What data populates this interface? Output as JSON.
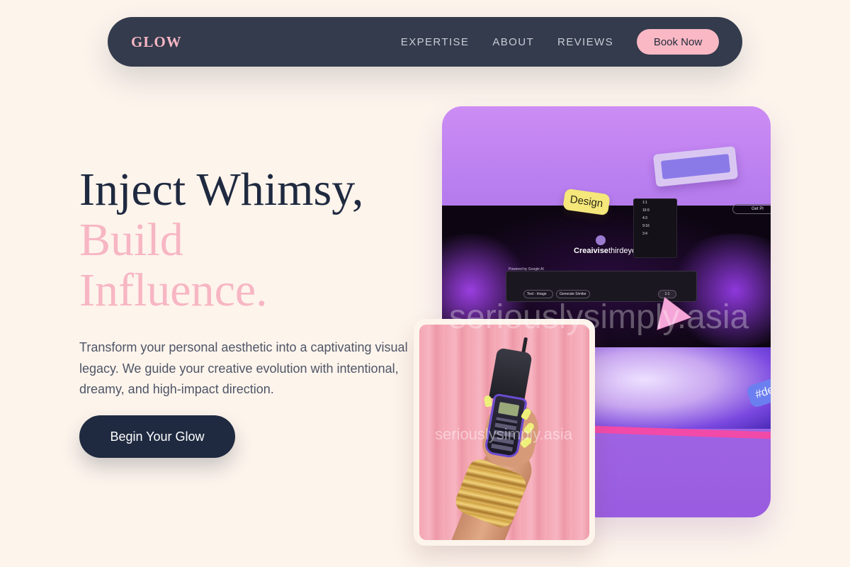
{
  "nav": {
    "logo": "GLOW",
    "links": [
      "EXPERTISE",
      "ABOUT",
      "REVIEWS"
    ],
    "cta": "Book Now"
  },
  "hero": {
    "headline_line1": "Inject Whimsy,",
    "headline_line2": "Build",
    "headline_line3": "Influence.",
    "description": "Transform your personal aesthetic into a captivating visual legacy. We guide your creative evolution with intentional, dreamy, and high-impact direction.",
    "cta": "Begin Your Glow"
  },
  "main_image": {
    "design_tag": "Design",
    "brand_bold": "Creaivise",
    "brand_light": "thirdeye",
    "powered_by": "Powered by Google AI",
    "chip_text_image": "Text - Image",
    "chip_generate_similar": "Generate Similar",
    "chip_ratio": "1:1",
    "ratios": [
      "1:1",
      "16:9",
      "4:3",
      "9:16",
      "3:4"
    ],
    "top_right_button": "Get Pl",
    "hash_tag": "#de",
    "watermark": "seriouslysimply.asia"
  },
  "photo_card": {
    "watermark": "seriouslysimply.asia"
  },
  "colors": {
    "background": "#fdf4ec",
    "nav_bg": "#333b4c",
    "accent_pink": "#f7b6c3",
    "dark_text": "#1f2a40",
    "body_text": "#4e5566",
    "purple": "#b67cee"
  }
}
